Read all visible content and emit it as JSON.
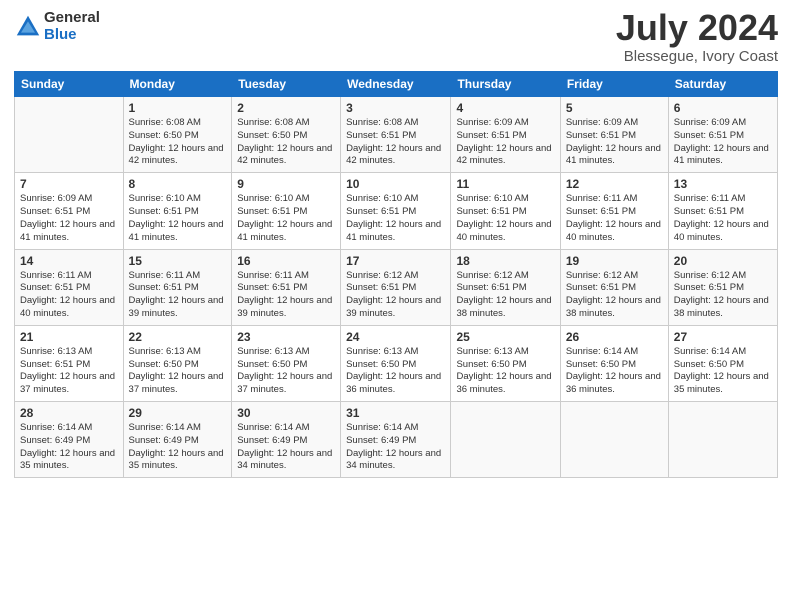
{
  "logo": {
    "general": "General",
    "blue": "Blue"
  },
  "header": {
    "month": "July 2024",
    "location": "Blessegue, Ivory Coast"
  },
  "weekdays": [
    "Sunday",
    "Monday",
    "Tuesday",
    "Wednesday",
    "Thursday",
    "Friday",
    "Saturday"
  ],
  "weeks": [
    [
      {
        "day": "",
        "sunrise": "",
        "sunset": "",
        "daylight": ""
      },
      {
        "day": "1",
        "sunrise": "Sunrise: 6:08 AM",
        "sunset": "Sunset: 6:50 PM",
        "daylight": "Daylight: 12 hours and 42 minutes."
      },
      {
        "day": "2",
        "sunrise": "Sunrise: 6:08 AM",
        "sunset": "Sunset: 6:50 PM",
        "daylight": "Daylight: 12 hours and 42 minutes."
      },
      {
        "day": "3",
        "sunrise": "Sunrise: 6:08 AM",
        "sunset": "Sunset: 6:51 PM",
        "daylight": "Daylight: 12 hours and 42 minutes."
      },
      {
        "day": "4",
        "sunrise": "Sunrise: 6:09 AM",
        "sunset": "Sunset: 6:51 PM",
        "daylight": "Daylight: 12 hours and 42 minutes."
      },
      {
        "day": "5",
        "sunrise": "Sunrise: 6:09 AM",
        "sunset": "Sunset: 6:51 PM",
        "daylight": "Daylight: 12 hours and 41 minutes."
      },
      {
        "day": "6",
        "sunrise": "Sunrise: 6:09 AM",
        "sunset": "Sunset: 6:51 PM",
        "daylight": "Daylight: 12 hours and 41 minutes."
      }
    ],
    [
      {
        "day": "7",
        "sunrise": "Sunrise: 6:09 AM",
        "sunset": "Sunset: 6:51 PM",
        "daylight": "Daylight: 12 hours and 41 minutes."
      },
      {
        "day": "8",
        "sunrise": "Sunrise: 6:10 AM",
        "sunset": "Sunset: 6:51 PM",
        "daylight": "Daylight: 12 hours and 41 minutes."
      },
      {
        "day": "9",
        "sunrise": "Sunrise: 6:10 AM",
        "sunset": "Sunset: 6:51 PM",
        "daylight": "Daylight: 12 hours and 41 minutes."
      },
      {
        "day": "10",
        "sunrise": "Sunrise: 6:10 AM",
        "sunset": "Sunset: 6:51 PM",
        "daylight": "Daylight: 12 hours and 41 minutes."
      },
      {
        "day": "11",
        "sunrise": "Sunrise: 6:10 AM",
        "sunset": "Sunset: 6:51 PM",
        "daylight": "Daylight: 12 hours and 40 minutes."
      },
      {
        "day": "12",
        "sunrise": "Sunrise: 6:11 AM",
        "sunset": "Sunset: 6:51 PM",
        "daylight": "Daylight: 12 hours and 40 minutes."
      },
      {
        "day": "13",
        "sunrise": "Sunrise: 6:11 AM",
        "sunset": "Sunset: 6:51 PM",
        "daylight": "Daylight: 12 hours and 40 minutes."
      }
    ],
    [
      {
        "day": "14",
        "sunrise": "Sunrise: 6:11 AM",
        "sunset": "Sunset: 6:51 PM",
        "daylight": "Daylight: 12 hours and 40 minutes."
      },
      {
        "day": "15",
        "sunrise": "Sunrise: 6:11 AM",
        "sunset": "Sunset: 6:51 PM",
        "daylight": "Daylight: 12 hours and 39 minutes."
      },
      {
        "day": "16",
        "sunrise": "Sunrise: 6:11 AM",
        "sunset": "Sunset: 6:51 PM",
        "daylight": "Daylight: 12 hours and 39 minutes."
      },
      {
        "day": "17",
        "sunrise": "Sunrise: 6:12 AM",
        "sunset": "Sunset: 6:51 PM",
        "daylight": "Daylight: 12 hours and 39 minutes."
      },
      {
        "day": "18",
        "sunrise": "Sunrise: 6:12 AM",
        "sunset": "Sunset: 6:51 PM",
        "daylight": "Daylight: 12 hours and 38 minutes."
      },
      {
        "day": "19",
        "sunrise": "Sunrise: 6:12 AM",
        "sunset": "Sunset: 6:51 PM",
        "daylight": "Daylight: 12 hours and 38 minutes."
      },
      {
        "day": "20",
        "sunrise": "Sunrise: 6:12 AM",
        "sunset": "Sunset: 6:51 PM",
        "daylight": "Daylight: 12 hours and 38 minutes."
      }
    ],
    [
      {
        "day": "21",
        "sunrise": "Sunrise: 6:13 AM",
        "sunset": "Sunset: 6:51 PM",
        "daylight": "Daylight: 12 hours and 37 minutes."
      },
      {
        "day": "22",
        "sunrise": "Sunrise: 6:13 AM",
        "sunset": "Sunset: 6:50 PM",
        "daylight": "Daylight: 12 hours and 37 minutes."
      },
      {
        "day": "23",
        "sunrise": "Sunrise: 6:13 AM",
        "sunset": "Sunset: 6:50 PM",
        "daylight": "Daylight: 12 hours and 37 minutes."
      },
      {
        "day": "24",
        "sunrise": "Sunrise: 6:13 AM",
        "sunset": "Sunset: 6:50 PM",
        "daylight": "Daylight: 12 hours and 36 minutes."
      },
      {
        "day": "25",
        "sunrise": "Sunrise: 6:13 AM",
        "sunset": "Sunset: 6:50 PM",
        "daylight": "Daylight: 12 hours and 36 minutes."
      },
      {
        "day": "26",
        "sunrise": "Sunrise: 6:14 AM",
        "sunset": "Sunset: 6:50 PM",
        "daylight": "Daylight: 12 hours and 36 minutes."
      },
      {
        "day": "27",
        "sunrise": "Sunrise: 6:14 AM",
        "sunset": "Sunset: 6:50 PM",
        "daylight": "Daylight: 12 hours and 35 minutes."
      }
    ],
    [
      {
        "day": "28",
        "sunrise": "Sunrise: 6:14 AM",
        "sunset": "Sunset: 6:49 PM",
        "daylight": "Daylight: 12 hours and 35 minutes."
      },
      {
        "day": "29",
        "sunrise": "Sunrise: 6:14 AM",
        "sunset": "Sunset: 6:49 PM",
        "daylight": "Daylight: 12 hours and 35 minutes."
      },
      {
        "day": "30",
        "sunrise": "Sunrise: 6:14 AM",
        "sunset": "Sunset: 6:49 PM",
        "daylight": "Daylight: 12 hours and 34 minutes."
      },
      {
        "day": "31",
        "sunrise": "Sunrise: 6:14 AM",
        "sunset": "Sunset: 6:49 PM",
        "daylight": "Daylight: 12 hours and 34 minutes."
      },
      {
        "day": "",
        "sunrise": "",
        "sunset": "",
        "daylight": ""
      },
      {
        "day": "",
        "sunrise": "",
        "sunset": "",
        "daylight": ""
      },
      {
        "day": "",
        "sunrise": "",
        "sunset": "",
        "daylight": ""
      }
    ]
  ]
}
